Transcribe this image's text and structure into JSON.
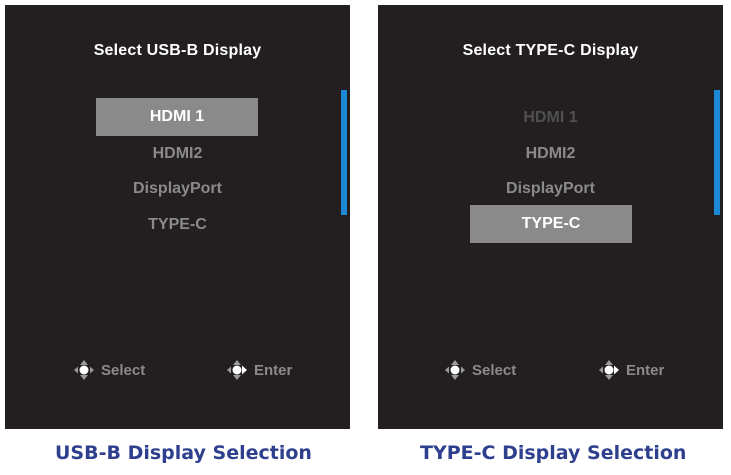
{
  "panels": [
    {
      "title": "Select USB-B Display",
      "options": [
        "HDMI 1",
        "HDMI2",
        "DisplayPort",
        "TYPE-C"
      ],
      "selected": "HDMI 1",
      "hints": {
        "select_label": "Select",
        "enter_label": "Enter"
      },
      "caption": "USB-B Display Selection"
    },
    {
      "title": "Select TYPE-C Display",
      "options": [
        "HDMI 1",
        "HDMI2",
        "DisplayPort",
        "TYPE-C"
      ],
      "selected": "TYPE-C",
      "hints": {
        "select_label": "Select",
        "enter_label": "Enter"
      },
      "caption": "TYPE-C Display Selection"
    }
  ],
  "icons": {
    "select": "dpad-up-down-icon",
    "enter": "dpad-right-icon"
  },
  "colors": {
    "panel_background": "#231f20",
    "highlight": "#8a8a8a",
    "scroll_indicator": "#1d88d6",
    "caption": "#2e3f8e"
  }
}
